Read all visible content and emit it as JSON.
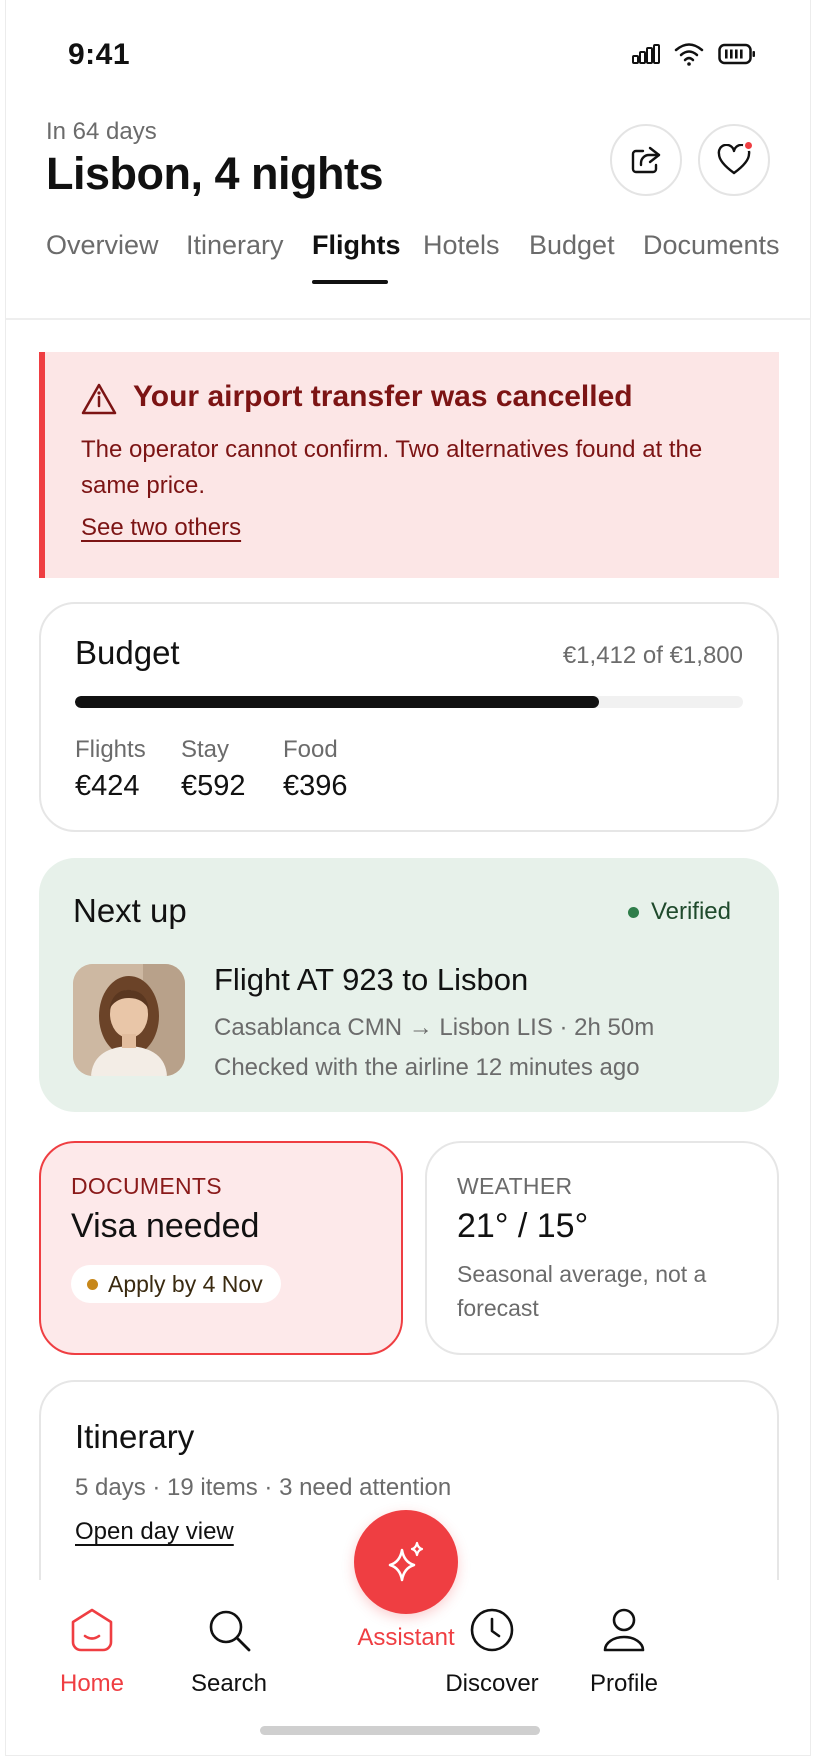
{
  "status_bar": {
    "time": "9:41"
  },
  "header": {
    "eyebrow": "In 64 days",
    "title": "Lisbon, 4 nights",
    "share_icon": "share-icon",
    "favorite_icon": "heart-icon"
  },
  "tabs": [
    {
      "label": "Overview",
      "active": false
    },
    {
      "label": "Itinerary",
      "active": false
    },
    {
      "label": "Flights",
      "active": true
    },
    {
      "label": "Hotels",
      "active": false
    },
    {
      "label": "Budget",
      "active": false
    },
    {
      "label": "Documents",
      "active": false
    }
  ],
  "alert": {
    "title": "Your airport transfer was cancelled",
    "body": "The operator cannot confirm. Two alternatives found at the same price.",
    "link": "See two others",
    "icon": "info-icon"
  },
  "budget": {
    "title": "Budget",
    "total": "€1,412 of €1,800",
    "spent_fraction": 0.784,
    "categories": [
      {
        "label": "Flights",
        "value": "€424"
      },
      {
        "label": "Stay",
        "value": "€592"
      },
      {
        "label": "Food",
        "value": "€396"
      }
    ]
  },
  "next_up": {
    "title": "Next up",
    "status": "Verified",
    "flight_title": "Flight AT 923 to Lisbon",
    "route": "Casablanca CMN → Lisbon LIS · 2h 50m",
    "checked": "Checked with the airline 12 minutes ago"
  },
  "documents": {
    "caption": "DOCUMENTS",
    "title": "Visa needed",
    "pill": "Apply by 4 Nov"
  },
  "weather": {
    "caption": "WEATHER",
    "title": "21° / 15°",
    "note": "Seasonal average, not a forecast"
  },
  "itinerary": {
    "title": "Itinerary",
    "subtitle": "5 days · 19 items · 3 need attention",
    "link": "Open day view"
  },
  "bottom_nav": {
    "home": "Home",
    "search": "Search",
    "assistant": "Assistant",
    "discover": "Discover",
    "profile": "Profile"
  },
  "colors": {
    "accent": "#ef3e42",
    "alert_bg": "#fce6e6",
    "alert_text": "#7c1414",
    "next_up_bg": "#e7f1ea",
    "verified": "#2f7d4a",
    "pill_dot": "#c7871a"
  }
}
